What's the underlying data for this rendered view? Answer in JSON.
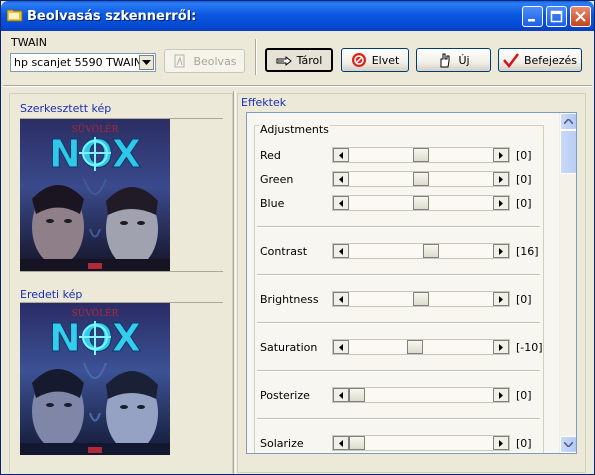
{
  "window": {
    "title": "Beolvasás szkennerről:"
  },
  "twain": {
    "label": "TWAIN",
    "device_value": "hp scanjet 5590 TWAIN",
    "scan_label": "Beolvas"
  },
  "toolbar": {
    "store_label": "Tárol",
    "discard_label": "Elvet",
    "new_label": "Új",
    "finish_label": "Befejezés"
  },
  "left": {
    "edited_label": "Szerkesztett kép",
    "original_label": "Eredeti kép",
    "cover_top_text": "SÜVÖLÉR",
    "cover_logo_text": "NOX"
  },
  "effects": {
    "label": "Effektek",
    "adjustments_label": "Adjustments",
    "rows": [
      {
        "label": "Red",
        "value": "[0]",
        "level": 0.5
      },
      {
        "label": "Green",
        "value": "[0]",
        "level": 0.5
      },
      {
        "label": "Blue",
        "value": "[0]",
        "level": 0.5
      },
      {
        "label": "Contrast",
        "value": "[16]",
        "level": 0.58
      },
      {
        "label": "Brightness",
        "value": "[0]",
        "level": 0.5
      },
      {
        "label": "Saturation",
        "value": "[-10]",
        "level": 0.45
      },
      {
        "label": "Posterize",
        "value": "[0]",
        "level": 0
      },
      {
        "label": "Solarize",
        "value": "[0]",
        "level": 0
      }
    ]
  }
}
